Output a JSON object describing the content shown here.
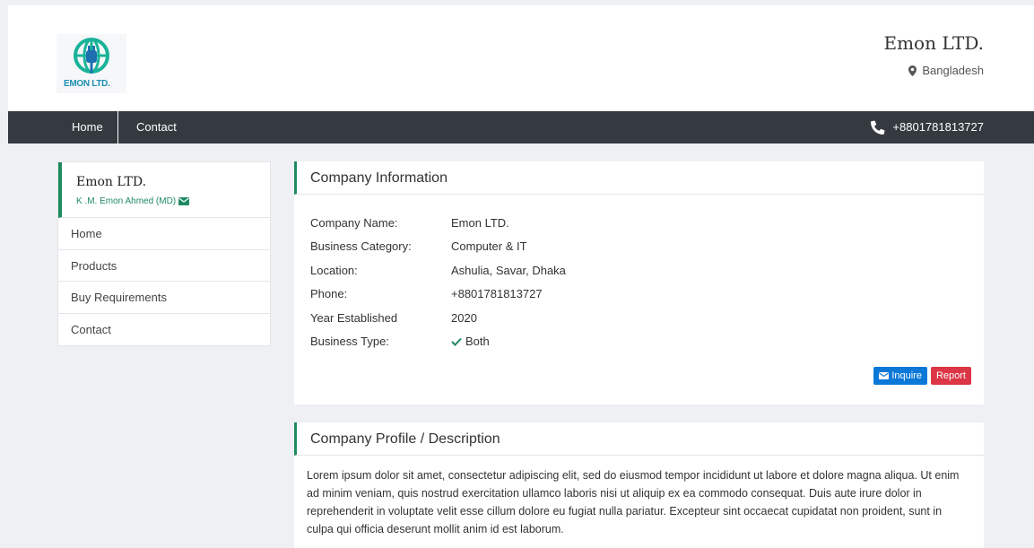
{
  "header": {
    "logo_text": "EMON LTD.",
    "brand": "Emon LTD.",
    "country": "Bangladesh"
  },
  "nav": {
    "items": [
      {
        "label": "Home"
      },
      {
        "label": "Contact"
      }
    ],
    "phone": "+8801781813727"
  },
  "sidebar": {
    "title": "Emon LTD.",
    "subtitle": "K .M. Emon Ahmed (MD)",
    "items": [
      {
        "label": "Home"
      },
      {
        "label": "Products"
      },
      {
        "label": "Buy Requirements"
      },
      {
        "label": "Contact"
      }
    ]
  },
  "company_info": {
    "heading": "Company Information",
    "rows": [
      {
        "key": "Company Name:",
        "value": "Emon LTD."
      },
      {
        "key": "Business Category:",
        "value": "Computer & IT"
      },
      {
        "key": "Location:",
        "value": "Ashulia, Savar, Dhaka"
      },
      {
        "key": "Phone:",
        "value": "+8801781813727"
      },
      {
        "key": "Year Established",
        "value": "2020"
      },
      {
        "key": "Business Type:",
        "value": "Both"
      }
    ],
    "inquire_label": "Inquire",
    "report_label": "Report"
  },
  "profile": {
    "heading": "Company Profile / Description",
    "text": "Lorem ipsum dolor sit amet, consectetur adipiscing elit, sed do eiusmod tempor incididunt ut labore et dolore magna aliqua. Ut enim ad minim veniam, quis nostrud exercitation ullamco laboris nisi ut aliquip ex ea commodo consequat. Duis aute irure dolor in reprehenderit in voluptate velit esse cillum dolore eu fugiat nulla pariatur. Excepteur sint occaecat cupidatat non proident, sunt in culpa qui officia deserunt mollit anim id est laborum."
  },
  "colors": {
    "accent": "#1f8a5f",
    "navbar": "#343a40",
    "inquire": "#0b78d8",
    "report": "#dc3545"
  }
}
